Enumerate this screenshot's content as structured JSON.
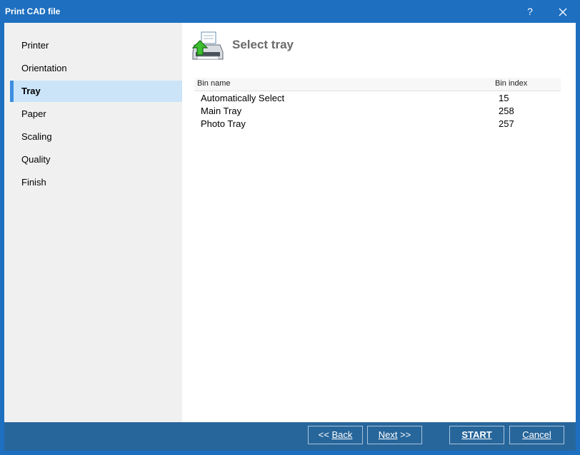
{
  "window": {
    "title": "Print CAD file",
    "help_glyph": "?"
  },
  "sidebar": {
    "items": [
      {
        "label": "Printer"
      },
      {
        "label": "Orientation"
      },
      {
        "label": "Tray",
        "active": true
      },
      {
        "label": "Paper"
      },
      {
        "label": "Scaling"
      },
      {
        "label": "Quality"
      },
      {
        "label": "Finish"
      }
    ]
  },
  "main": {
    "title": "Select tray",
    "icon": "printer-arrow-icon",
    "table": {
      "headers": [
        "Bin name",
        "Bin index"
      ],
      "rows": [
        [
          "Automatically Select",
          "15"
        ],
        [
          "Main Tray",
          "258"
        ],
        [
          "Photo Tray",
          "257"
        ]
      ]
    }
  },
  "footer": {
    "back": {
      "prefix": "<< ",
      "label": "Back"
    },
    "next": {
      "label": "Next",
      "suffix": " >>"
    },
    "start": {
      "label": "START"
    },
    "cancel": {
      "label": "Cancel"
    }
  },
  "colors": {
    "titlebar": "#1e6fc0",
    "footer": "#27669b",
    "selection": "#cce4f7",
    "accent": "#3d8ee0"
  }
}
